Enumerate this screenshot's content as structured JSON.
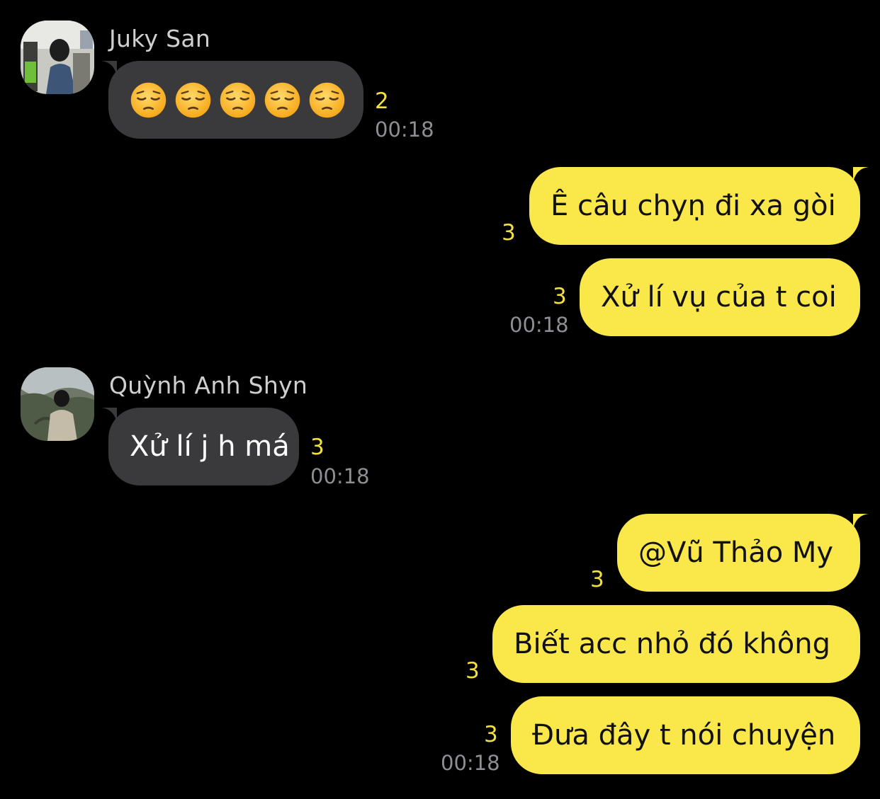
{
  "conversation": {
    "messages": [
      {
        "sender": "Juky San",
        "direction": "incoming",
        "emoji_count": 5,
        "emoji_icon": "pensive-face-icon",
        "read_count": "2",
        "time": "00:18"
      },
      {
        "direction": "outgoing",
        "text": "Ê câu chyṇ đi xa gòi",
        "read_count": "3"
      },
      {
        "direction": "outgoing",
        "text": "Xử lí vụ của t coi",
        "read_count": "3",
        "time": "00:18"
      },
      {
        "sender": "Quỳnh Anh Shyn",
        "direction": "incoming",
        "text": "Xử lí j h má",
        "read_count": "3",
        "time": "00:18"
      },
      {
        "direction": "outgoing",
        "text": "@Vũ Thảo My",
        "read_count": "3"
      },
      {
        "direction": "outgoing",
        "text": "Biết acc nhỏ đó không",
        "read_count": "3"
      },
      {
        "direction": "outgoing",
        "text": "Đưa đây t nói chuyện",
        "read_count": "3",
        "time": "00:18"
      }
    ]
  },
  "colors": {
    "background": "#000000",
    "incoming_bubble": "#3a3a3c",
    "outgoing_bubble": "#fae84a",
    "read_count": "#f3df3e",
    "timestamp": "#8e8e93",
    "sender_name": "#cfcfcf"
  }
}
